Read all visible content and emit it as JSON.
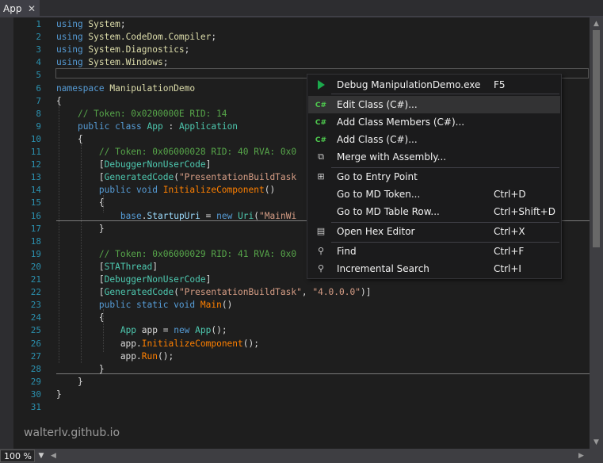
{
  "tab": {
    "title": "App",
    "close_glyph": "✕"
  },
  "editor": {
    "lines": [
      {
        "num": "1",
        "tokens": [
          [
            "kw",
            "using "
          ],
          [
            "ns",
            "System"
          ],
          [
            "",
            "; "
          ]
        ]
      },
      {
        "num": "2",
        "tokens": [
          [
            "kw",
            "using "
          ],
          [
            "ns",
            "System.CodeDom.Compiler"
          ],
          [
            "",
            ";"
          ]
        ]
      },
      {
        "num": "3",
        "tokens": [
          [
            "kw",
            "using "
          ],
          [
            "ns",
            "System.Diagnostics"
          ],
          [
            "",
            ";"
          ]
        ]
      },
      {
        "num": "4",
        "tokens": [
          [
            "kw",
            "using "
          ],
          [
            "ns",
            "System.Windows"
          ],
          [
            "",
            ";"
          ]
        ]
      },
      {
        "num": "5",
        "tokens": []
      },
      {
        "num": "6",
        "tokens": [
          [
            "kw",
            "namespace "
          ],
          [
            "ns",
            "ManipulationDemo"
          ]
        ]
      },
      {
        "num": "7",
        "tokens": [
          [
            "",
            "{"
          ]
        ]
      },
      {
        "num": "8",
        "tokens": [
          [
            "",
            "    "
          ],
          [
            "cm",
            "// Token: 0x0200000E RID: 14"
          ]
        ]
      },
      {
        "num": "9",
        "tokens": [
          [
            "",
            "    "
          ],
          [
            "kw",
            "public class "
          ],
          [
            "ty",
            "App"
          ],
          [
            "",
            " : "
          ],
          [
            "ty",
            "Application"
          ]
        ]
      },
      {
        "num": "10",
        "tokens": [
          [
            "",
            "    {"
          ]
        ]
      },
      {
        "num": "11",
        "tokens": [
          [
            "",
            "        "
          ],
          [
            "cm",
            "// Token: 0x06000028 RID: 40 RVA: 0x0"
          ]
        ]
      },
      {
        "num": "12",
        "tokens": [
          [
            "",
            "        ["
          ],
          [
            "ty",
            "DebuggerNonUserCode"
          ],
          [
            "",
            "]"
          ]
        ]
      },
      {
        "num": "13",
        "tokens": [
          [
            "",
            "        ["
          ],
          [
            "ty",
            "GeneratedCode"
          ],
          [
            "",
            "("
          ],
          [
            "st",
            "\"PresentationBuildTask"
          ]
        ]
      },
      {
        "num": "14",
        "tokens": [
          [
            "",
            "        "
          ],
          [
            "kw",
            "public void "
          ],
          [
            "me",
            "InitializeComponent"
          ],
          [
            "",
            "()"
          ]
        ]
      },
      {
        "num": "15",
        "tokens": [
          [
            "",
            "        {"
          ]
        ]
      },
      {
        "num": "16",
        "tokens": [
          [
            "",
            "            "
          ],
          [
            "kw",
            "base"
          ],
          [
            "",
            "."
          ],
          [
            "pr",
            "StartupUri"
          ],
          [
            "",
            " = "
          ],
          [
            "kw",
            "new "
          ],
          [
            "ty",
            "Uri"
          ],
          [
            "",
            "("
          ],
          [
            "st",
            "\"MainWi"
          ]
        ]
      },
      {
        "num": "17",
        "tokens": [
          [
            "",
            "        }"
          ]
        ]
      },
      {
        "num": "18",
        "tokens": []
      },
      {
        "num": "19",
        "tokens": [
          [
            "",
            "        "
          ],
          [
            "cm",
            "// Token: 0x06000029 RID: 41 RVA: 0x0"
          ]
        ]
      },
      {
        "num": "20",
        "tokens": [
          [
            "",
            "        ["
          ],
          [
            "ty",
            "STAThread"
          ],
          [
            "",
            "]"
          ]
        ]
      },
      {
        "num": "21",
        "tokens": [
          [
            "",
            "        ["
          ],
          [
            "ty",
            "DebuggerNonUserCode"
          ],
          [
            "",
            "]"
          ]
        ]
      },
      {
        "num": "22",
        "tokens": [
          [
            "",
            "        ["
          ],
          [
            "ty",
            "GeneratedCode"
          ],
          [
            "",
            "("
          ],
          [
            "st",
            "\"PresentationBuildTask\""
          ],
          [
            "",
            ", "
          ],
          [
            "st",
            "\"4.0.0.0\""
          ],
          [
            "",
            ")]"
          ]
        ]
      },
      {
        "num": "23",
        "tokens": [
          [
            "",
            "        "
          ],
          [
            "kw",
            "public static void "
          ],
          [
            "me",
            "Main"
          ],
          [
            "",
            "()"
          ]
        ]
      },
      {
        "num": "24",
        "tokens": [
          [
            "",
            "        {"
          ]
        ]
      },
      {
        "num": "25",
        "tokens": [
          [
            "",
            "            "
          ],
          [
            "ty",
            "App"
          ],
          [
            "",
            " app = "
          ],
          [
            "kw",
            "new "
          ],
          [
            "ty",
            "App"
          ],
          [
            "",
            "();"
          ]
        ]
      },
      {
        "num": "26",
        "tokens": [
          [
            "",
            "            app."
          ],
          [
            "me",
            "InitializeComponent"
          ],
          [
            "",
            "();"
          ]
        ]
      },
      {
        "num": "27",
        "tokens": [
          [
            "",
            "            app."
          ],
          [
            "me",
            "Run"
          ],
          [
            "",
            "();"
          ]
        ]
      },
      {
        "num": "28",
        "tokens": [
          [
            "",
            "        }"
          ]
        ]
      },
      {
        "num": "29",
        "tokens": [
          [
            "",
            "    }"
          ]
        ]
      },
      {
        "num": "30",
        "tokens": [
          [
            "",
            "}"
          ]
        ]
      },
      {
        "num": "31",
        "tokens": []
      }
    ]
  },
  "context_menu": {
    "items": [
      {
        "icon": "play-icon",
        "label": "Debug ManipulationDemo.exe",
        "shortcut": "F5"
      },
      {
        "icon": "csharp-icon",
        "label": "Edit Class (C#)...",
        "shortcut": "",
        "highlighted": true
      },
      {
        "icon": "csharp-icon",
        "label": "Add Class Members (C#)...",
        "shortcut": ""
      },
      {
        "icon": "csharp-icon",
        "label": "Add Class (C#)...",
        "shortcut": ""
      },
      {
        "icon": "merge-icon",
        "label": "Merge with Assembly...",
        "shortcut": ""
      },
      {
        "icon": "entry-point-icon",
        "label": "Go to Entry Point",
        "shortcut": ""
      },
      {
        "icon": "",
        "label": "Go to MD Token...",
        "shortcut": "Ctrl+D"
      },
      {
        "icon": "",
        "label": "Go to MD Table Row...",
        "shortcut": "Ctrl+Shift+D"
      },
      {
        "icon": "hex-editor-icon",
        "label": "Open Hex Editor",
        "shortcut": "Ctrl+X"
      },
      {
        "icon": "search-icon",
        "label": "Find",
        "shortcut": "Ctrl+F"
      },
      {
        "icon": "search-icon",
        "label": "Incremental Search",
        "shortcut": "Ctrl+I"
      }
    ]
  },
  "status": {
    "zoom": "100 %"
  },
  "watermark": "walterlv.github.io",
  "colors": {
    "accent_green": "#1ba94c",
    "csharp_green": "#4ec94e",
    "line_number": "#2b91af"
  }
}
